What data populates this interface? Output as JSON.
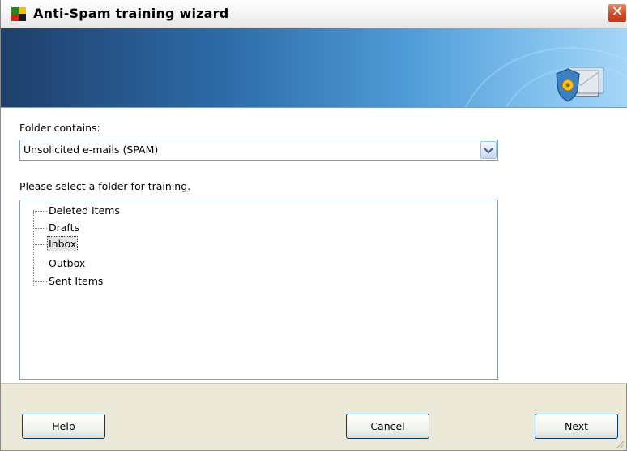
{
  "window": {
    "title": "Anti-Spam training wizard",
    "close_glyph": "✕",
    "app_icon": "avg-logo-icon",
    "banner_icon": "antispam-mail-icon"
  },
  "form": {
    "folder_contains_label": "Folder contains:",
    "folder_contains_value": "Unsolicited e-mails (SPAM)",
    "select_folder_label": "Please select a folder for training."
  },
  "tree": {
    "items": [
      {
        "label": "Deleted Items",
        "selected": false
      },
      {
        "label": "Drafts",
        "selected": false
      },
      {
        "label": "Inbox",
        "selected": true
      },
      {
        "label": "Outbox",
        "selected": false
      },
      {
        "label": "Sent Items",
        "selected": false
      }
    ]
  },
  "buttons": {
    "help": "Help",
    "cancel": "Cancel",
    "next": "Next"
  },
  "colors": {
    "banner_dark": "#1f3f6b",
    "banner_light": "#a6d6f6",
    "close_button": "#cf4b2a",
    "dialog_face": "#ece9d8",
    "field_border": "#7f9db9"
  }
}
